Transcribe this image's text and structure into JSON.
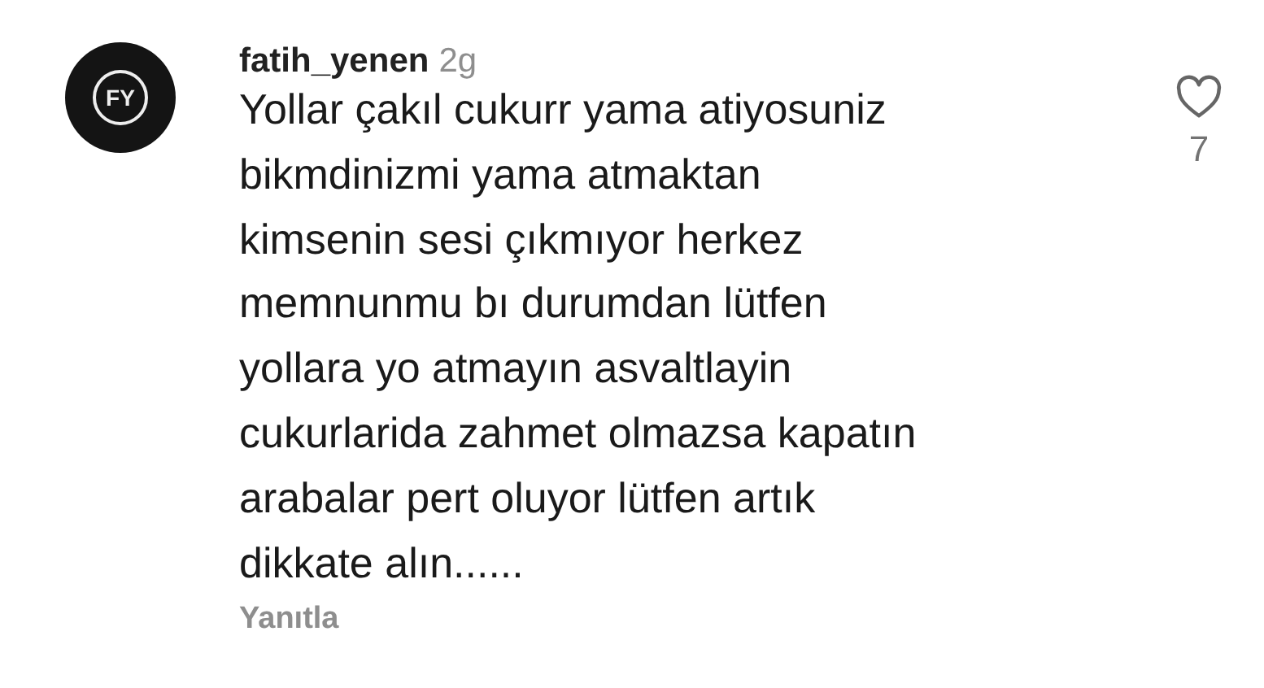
{
  "comment": {
    "avatar_initials": "FY",
    "username": "fatih_yenen",
    "time": "2g",
    "text": "Yollar çakıl cukurr yama atiyosuniz\nbikmdinizmi yama atmaktan\nkimsenin sesi çıkmıyor herkez\nmemnunmu bı durumdan lütfen\nyollara yo atmayın asvaltlayin\ncukurlarida zahmet olmazsa kapatın\narabalar pert oluyor lütfen artık\ndikkate alın......",
    "reply": "Yanıtla",
    "liked": false,
    "likes": "7"
  }
}
